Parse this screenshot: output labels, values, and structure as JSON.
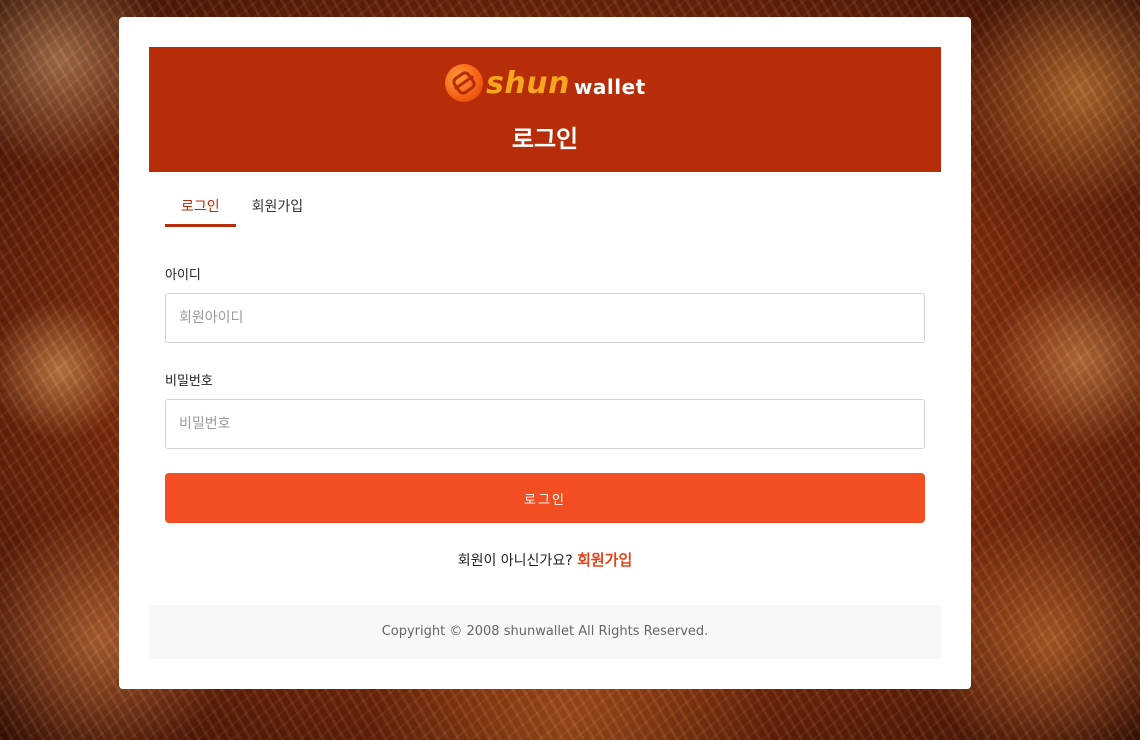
{
  "brand": {
    "logo_shun": "shun",
    "logo_wallet": "wallet",
    "logo_icon": "shunwallet-logo-icon",
    "primary_color": "#b72c09",
    "button_color": "#f24e22",
    "accent_color": "#f7a51c"
  },
  "header": {
    "title": "로그인"
  },
  "tabs": [
    {
      "label": "로그인",
      "active": true
    },
    {
      "label": "회원가입",
      "active": false
    }
  ],
  "form": {
    "id_label": "아이디",
    "id_placeholder": "회원아이디",
    "id_value": "",
    "password_label": "비밀번호",
    "password_placeholder": "비밀번호",
    "password_value": "",
    "submit_label": "로그인"
  },
  "signup": {
    "prompt": "회원이 아니신가요?",
    "link_label": "회원가입"
  },
  "footer": {
    "copyright": "Copyright © 2008 shunwallet All Rights Reserved."
  }
}
